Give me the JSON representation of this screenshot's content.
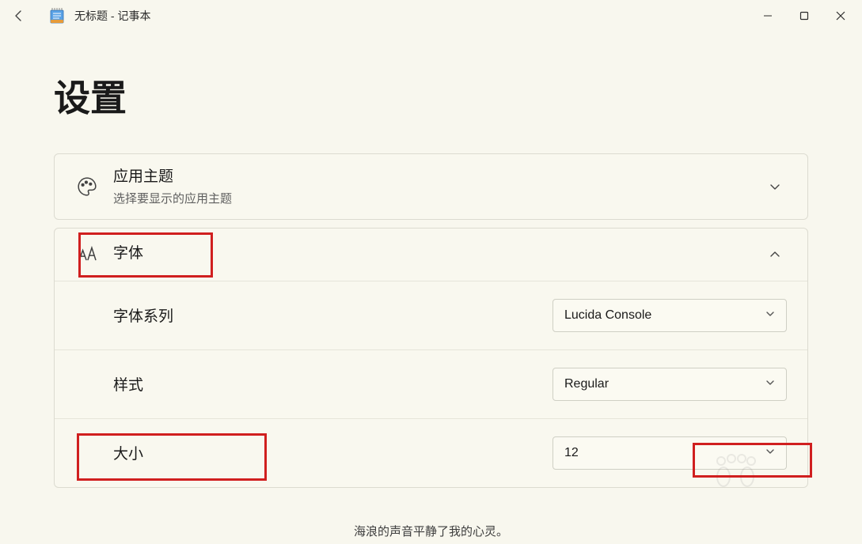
{
  "window": {
    "title": "无标题 - 记事本"
  },
  "page": {
    "heading": "设置"
  },
  "theme_card": {
    "title": "应用主题",
    "subtitle": "选择要显示的应用主题"
  },
  "font_card": {
    "title": "字体",
    "family_label": "字体系列",
    "family_value": "Lucida Console",
    "style_label": "样式",
    "style_value": "Regular",
    "size_label": "大小",
    "size_value": "12"
  },
  "footer": {
    "caption": "海浪的声音平静了我的心灵。"
  }
}
